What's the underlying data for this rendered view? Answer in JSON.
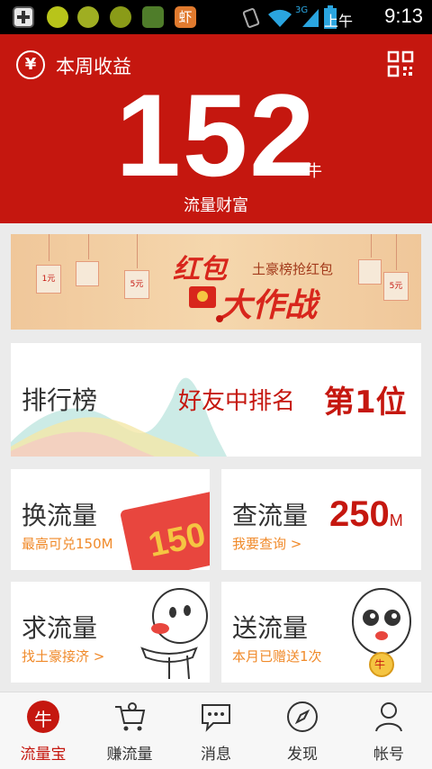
{
  "statusbar": {
    "ampm": "上午",
    "time": "9:13",
    "network": "3G",
    "notification_icon": "虾"
  },
  "header": {
    "title": "本周收益",
    "currency_symbol": "¥",
    "value": "152",
    "unit": "牛",
    "caption": "流量财富"
  },
  "banner": {
    "title_line1": "红包",
    "subtitle": "土豪榜抢红包",
    "title_line2": "大作战",
    "envelopes": [
      "1元",
      "5元",
      "5元"
    ]
  },
  "ranking": {
    "title": "排行榜",
    "friend_label": "好友中排名",
    "position": "第1位"
  },
  "cards": {
    "exchange": {
      "title": "换流量",
      "subtitle": "最高可兑150M",
      "badge": "150"
    },
    "query": {
      "title": "查流量",
      "subtitle": "我要查询 >",
      "value": "250",
      "unit": "M"
    },
    "request": {
      "title": "求流量",
      "subtitle": "找土豪接济 >"
    },
    "give": {
      "title": "送流量",
      "subtitle": "本月已赠送1次",
      "coin_label": "牛"
    }
  },
  "tabs": [
    {
      "label": "流量宝",
      "icon": "niu-icon",
      "active": true,
      "glyph": "牛"
    },
    {
      "label": "赚流量",
      "icon": "cart-icon"
    },
    {
      "label": "消息",
      "icon": "chat-icon"
    },
    {
      "label": "发现",
      "icon": "compass-icon"
    },
    {
      "label": "帐号",
      "icon": "person-icon"
    }
  ],
  "colors": {
    "brand_red": "#c5170f",
    "accent_orange": "#f08a2a",
    "background": "#ebebeb"
  }
}
